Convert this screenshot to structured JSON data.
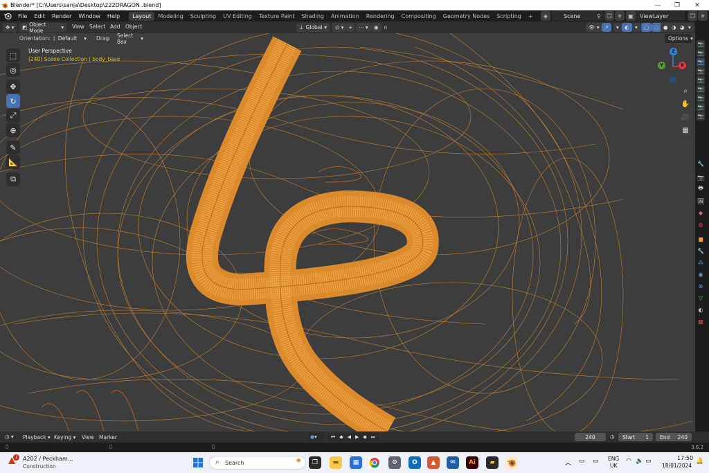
{
  "window": {
    "title": "Blender* [C:\\Users\\sanja\\Desktop\\222DRAGON .blend]",
    "controls": [
      "—",
      "❐",
      "✕"
    ]
  },
  "topbar": {
    "menus": [
      "File",
      "Edit",
      "Render",
      "Window",
      "Help"
    ],
    "workspaces": [
      "Layout",
      "Modeling",
      "Sculpting",
      "UV Editing",
      "Texture Paint",
      "Shading",
      "Animation",
      "Rendering",
      "Compositing",
      "Geometry Nodes",
      "Scripting"
    ],
    "active_workspace": "Layout",
    "add_tab": "+",
    "scene": "Scene",
    "view_layer": "ViewLayer"
  },
  "view_header": {
    "mode": "Object Mode",
    "menus": [
      "View",
      "Select",
      "Add",
      "Object"
    ],
    "transform_orientation": "Global",
    "options": "Options"
  },
  "tool_settings": {
    "orientation_label": "Orientation:",
    "orientation_value": "Default",
    "drag_label": "Drag:",
    "drag_value": "Select Box"
  },
  "viewport": {
    "view_name": "User Perspective",
    "collection_info": "(240) Scene Collection | body_base",
    "gizmo_axes": {
      "z": "Z",
      "y": "Y",
      "x": "X"
    },
    "colors": {
      "background": "#3d3d3d",
      "wire": "#f39c2f",
      "info_yellow": "#e0c000",
      "tool_active": "#4772b3"
    }
  },
  "toolbar_tools": [
    "select-box",
    "cursor",
    "move",
    "rotate",
    "scale",
    "transform",
    "annotate",
    "measure",
    "add-cube"
  ],
  "timeline": {
    "menus": [
      "Playback",
      "Keying",
      "View",
      "Marker"
    ],
    "current_frame": "240",
    "start_label": "Start",
    "start_value": "1",
    "end_label": "End",
    "end_value": "240"
  },
  "statusbar": {
    "version": "3.6.2"
  },
  "taskbar": {
    "weather_title": "A202 / Peckham...",
    "weather_sub": "Construction",
    "weather_badge": "1",
    "search_placeholder": "Search",
    "language": "ENG",
    "region": "UK",
    "time": "17:50",
    "date": "18/01/2024"
  }
}
